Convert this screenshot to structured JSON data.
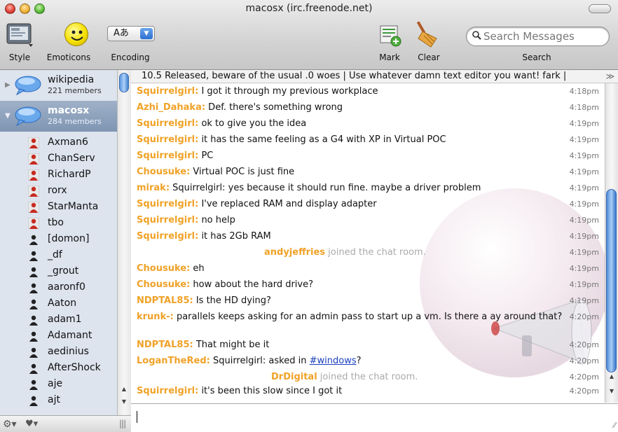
{
  "window": {
    "title": "macosx (irc.freenode.net)"
  },
  "toolbar": {
    "style_label": "Style",
    "emoticons_label": "Emoticons",
    "encoding_label": "Encoding",
    "encoding_value": "Aあ",
    "mark_label": "Mark",
    "clear_label": "Clear",
    "search_label": "Search",
    "search_placeholder": "Search Messages"
  },
  "channels": [
    {
      "name": "wikipedia",
      "members": "221 members",
      "selected": false
    },
    {
      "name": "macosx",
      "members": "284 members",
      "selected": true
    }
  ],
  "members": [
    {
      "name": "Axman6",
      "op": true
    },
    {
      "name": "ChanServ",
      "op": true
    },
    {
      "name": "RichardP",
      "op": true
    },
    {
      "name": "rorx",
      "op": true
    },
    {
      "name": "StarManta",
      "op": true
    },
    {
      "name": "tbo",
      "op": true
    },
    {
      "name": "[domon]",
      "op": false
    },
    {
      "name": "_df",
      "op": false
    },
    {
      "name": "_grout",
      "op": false
    },
    {
      "name": "aaronf0",
      "op": false
    },
    {
      "name": "Aaton",
      "op": false
    },
    {
      "name": "adam1",
      "op": false
    },
    {
      "name": "Adamant",
      "op": false
    },
    {
      "name": "aedinius",
      "op": false
    },
    {
      "name": "AfterShock",
      "op": false
    },
    {
      "name": "aje",
      "op": false
    },
    {
      "name": "ajt",
      "op": false
    }
  ],
  "topic": "10.5 Released, beware of the usual .0 woes | Use whatever damn text editor you want! fark |",
  "messages": [
    {
      "nick": "Squirrelgirl:",
      "text": " I got it through my previous workplace",
      "time": "4:18pm"
    },
    {
      "nick": "Azhi_Dahaka:",
      "text": " Def. there's something wrong",
      "time": "4:18pm"
    },
    {
      "nick": "Squirrelgirl:",
      "text": " ok to give you the idea",
      "time": "4:19pm"
    },
    {
      "nick": "Squirrelgirl:",
      "text": " it has the same feeling as a G4 with XP in Virtual POC",
      "time": "4:19pm"
    },
    {
      "nick": "Squirrelgirl:",
      "text": " PC",
      "time": "4:19pm"
    },
    {
      "nick": "Chousuke:",
      "text": " Virtual POC is just fine",
      "time": "4:19pm"
    },
    {
      "nick": "mirak:",
      "text": " Squirrelgirl: yes because it should run fine. maybe a driver problem",
      "time": "4:19pm"
    },
    {
      "nick": "Squirrelgirl:",
      "text": " I've replaced RAM and display adapter",
      "time": "4:19pm"
    },
    {
      "nick": "Squirrelgirl:",
      "text": " no help",
      "time": "4:19pm"
    },
    {
      "nick": "Squirrelgirl:",
      "text": " it has 2Gb RAM",
      "time": "4:19pm"
    },
    {
      "join_nick": "andyjeffries",
      "join_text": " joined the chat room.",
      "time": "4:19pm"
    },
    {
      "nick": "Chousuke:",
      "text": " eh",
      "time": "4:19pm"
    },
    {
      "nick": "Chousuke:",
      "text": " how about the hard drive?",
      "time": "4:19pm"
    },
    {
      "nick": "NDPTAL85:",
      "text": " Is the HD dying?",
      "time": "4:19pm"
    },
    {
      "nick": "krunk-:",
      "text": " parallels keeps asking for an admin pass to start up a vm. Is there a ay around that?",
      "time": "4:20pm"
    },
    {
      "nick": "NDPTAL85:",
      "text": " That might be it",
      "time": "4:20pm"
    },
    {
      "nick": "LoganTheRed:",
      "text_before": " Squirrelgirl: asked in ",
      "link": "#windows",
      "text_after": "?",
      "time": "4:20pm"
    },
    {
      "join_nick": "DrDigital",
      "join_text": " joined the chat room.",
      "time": "4:20pm"
    },
    {
      "nick": "Squirrelgirl:",
      "text": " it's been this slow since I got it",
      "time": "4:20pm"
    }
  ],
  "colors": {
    "nick": "#f0a227",
    "selection": "#8fa3bf",
    "link": "#1a3fbf"
  },
  "icons": [
    "style-icon",
    "emoticons-icon",
    "mark-icon",
    "clear-broom-icon",
    "search-icon",
    "gear-icon",
    "heart-icon",
    "chat-bubble-icon",
    "user-icon"
  ]
}
